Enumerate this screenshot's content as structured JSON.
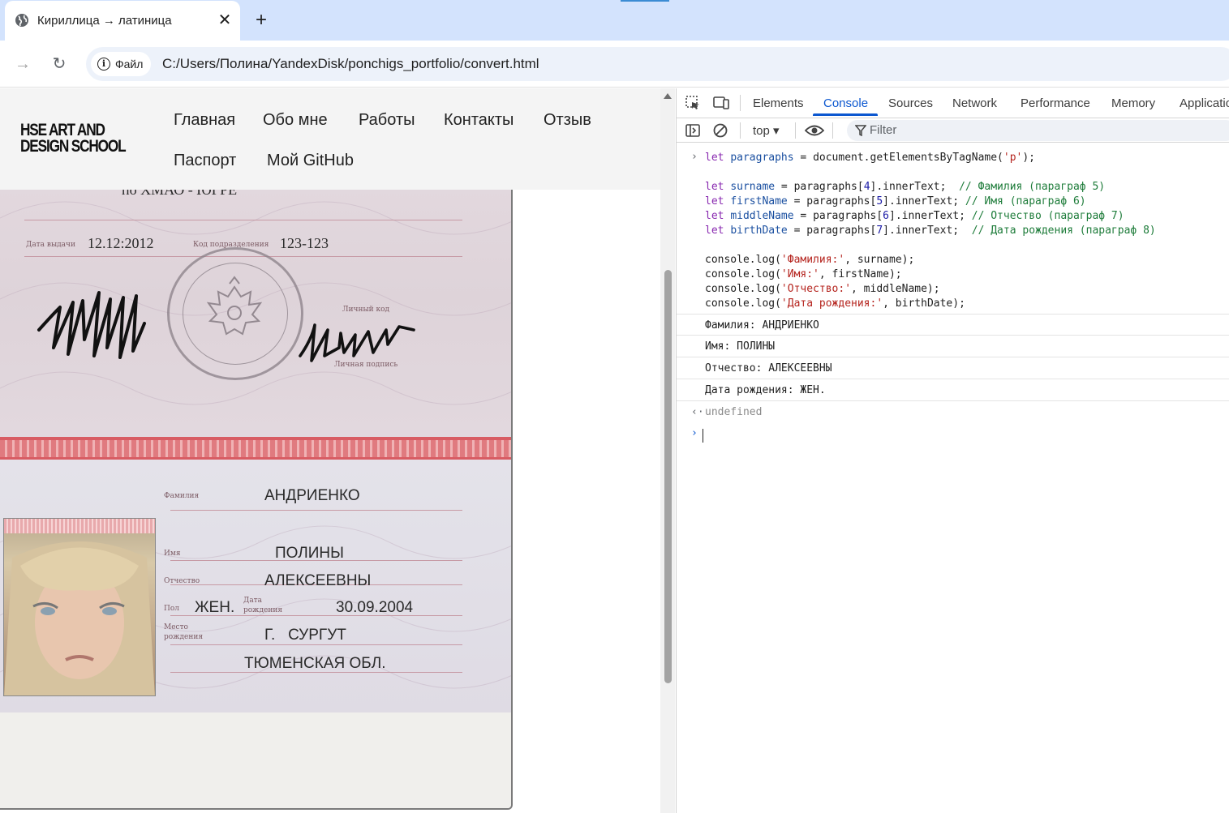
{
  "browser": {
    "tab_title": "Кириллица → латиница",
    "tab_close_glyph": "✕",
    "new_tab_glyph": "+",
    "chip_label": "Файл",
    "url": "C:/Users/Полина/YandexDisk/ponchigs_portfolio/convert.html"
  },
  "site": {
    "logo_line1": "HSE ART AND",
    "logo_line2": "DESIGN SCHOOL",
    "nav": [
      "Главная",
      "Обо мне",
      "Работы",
      "Контакты",
      "Отзыв",
      "Паспорт",
      "Мой GitHub"
    ]
  },
  "passport": {
    "issuer_partial": "по ХМАО - ЮГРЕ",
    "issue_date_label": "Дата выдачи",
    "issue_date": "12.12:2012",
    "division_code_label": "Код подразделения",
    "division_code": "123-123",
    "personal_code_label": "Личный код",
    "signature_label": "Личная подпись",
    "surname_label": "Фамилия",
    "surname": "АНДРИЕНКО",
    "name_label": "Имя",
    "name": "ПОЛИНЫ",
    "patronymic_label": "Отчество",
    "patronymic": "АЛЕКСЕЕВНЫ",
    "sex_label": "Пол",
    "sex": "ЖЕН.",
    "birth_date_label_1": "Дата",
    "birth_date_label_2": "рождения",
    "birth_date": "30.09.2004",
    "birth_place_label_1": "Место",
    "birth_place_label_2": "рождения",
    "birth_place_1": "Г.   СУРГУТ",
    "birth_place_2": "ТЮМЕНСКАЯ ОБЛ."
  },
  "devtools": {
    "tabs": [
      "Elements",
      "Console",
      "Sources",
      "Network",
      "Performance",
      "Memory",
      "Applicatio"
    ],
    "active_tab": "Console",
    "context": "top ▾",
    "filter_placeholder": "Filter",
    "code": {
      "l1_kw": "let",
      "l1_var": "paragraphs",
      "l1_rest_a": " = document.getElementsByTagName(",
      "l1_str": "'p'",
      "l1_rest_b": ");",
      "l2_var": "surname",
      "l2_rest_a": " = paragraphs[",
      "l2_num": "4",
      "l2_rest_b": "].innerText;  ",
      "l2_cmt": "// Фамилия (параграф 5)",
      "l3_var": "firstName",
      "l3_num": "5",
      "l3_rest_b": "].innerText; ",
      "l3_cmt": "// Имя (параграф 6)",
      "l4_var": "middleName",
      "l4_num": "6",
      "l4_cmt": "// Отчество (параграф 7)",
      "l5_var": "birthDate",
      "l5_num": "7",
      "l5_rest_b": "].innerText;  ",
      "l5_cmt": "// Дата рождения (параграф 8)",
      "log_prefix": "console.log(",
      "log1_str": "'Фамилия:'",
      "log1_rest": ", surname);",
      "log2_str": "'Имя:'",
      "log2_rest": ", firstName);",
      "log3_str": "'Отчество:'",
      "log3_rest": ", middleName);",
      "log4_str": "'Дата рождения:'",
      "log4_rest": ", birthDate);"
    },
    "outputs": [
      "Фамилия: АНДРИЕНКО",
      "Имя: ПОЛИНЫ",
      "Отчество: АЛЕКСЕЕВНЫ",
      "Дата рождения: ЖЕН."
    ],
    "return_value": "undefined"
  },
  "colors": {
    "accent": "#0b57d0",
    "tabbar": "#d3e3fd",
    "omnibox": "#edf2fa",
    "passport_band": "#e07a7f"
  }
}
